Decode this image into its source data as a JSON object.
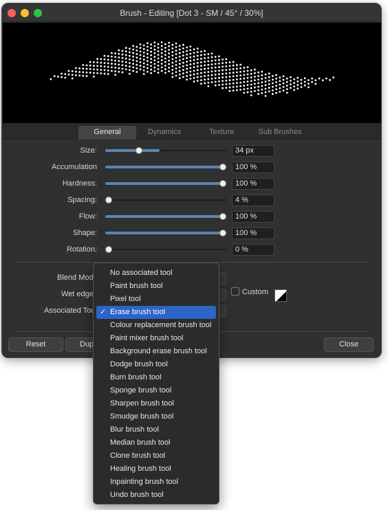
{
  "window": {
    "title": "Brush - Editing [Dot 3 - SM / 45° / 30%]"
  },
  "tabs": [
    "General",
    "Dynamics",
    "Texture",
    "Sub Brushes"
  ],
  "active_tab": "General",
  "parameters": [
    {
      "label": "Size:",
      "value": "34 px",
      "fraction": 0.28,
      "fill": 0.45
    },
    {
      "label": "Accumulation",
      "value": "100 %",
      "fraction": 1.0,
      "fill": 1.0
    },
    {
      "label": "Hardness:",
      "value": "100 %",
      "fraction": 1.0,
      "fill": 1.0
    },
    {
      "label": "Spacing:",
      "value": "4 %",
      "fraction": 0.02,
      "fill": 0.0
    },
    {
      "label": "Flow:",
      "value": "100 %",
      "fraction": 1.0,
      "fill": 1.0
    },
    {
      "label": "Shape:",
      "value": "100 %",
      "fraction": 1.0,
      "fill": 1.0
    },
    {
      "label": "Rotation:",
      "value": "0 %",
      "fraction": 0.0,
      "fill": 0.0
    }
  ],
  "lower": {
    "blend_mode_label": "Blend Mode",
    "wet_edge_label": "Wet edge",
    "associated_tool_label": "Associated Too",
    "custom_label": "Custom"
  },
  "buttons": {
    "reset": "Reset",
    "duplicate_partial": "Dup",
    "close": "Close"
  },
  "menu": {
    "items": [
      "No associated tool",
      "Paint brush tool",
      "Pixel tool",
      "Erase brush tool",
      "Colour replacement brush tool",
      "Paint mixer brush tool",
      "Background erase brush tool",
      "Dodge brush tool",
      "Burn brush tool",
      "Sponge brush tool",
      "Sharpen brush tool",
      "Smudge brush tool",
      "Blur brush tool",
      "Median brush tool",
      "Clone brush tool",
      "Healing brush tool",
      "Inpainting brush tool",
      "Undo brush tool"
    ],
    "selected_index": 3,
    "check_glyph": "✓"
  },
  "colors": {
    "accent": "#2c64c7",
    "slider_fill": "#5d84b3"
  }
}
